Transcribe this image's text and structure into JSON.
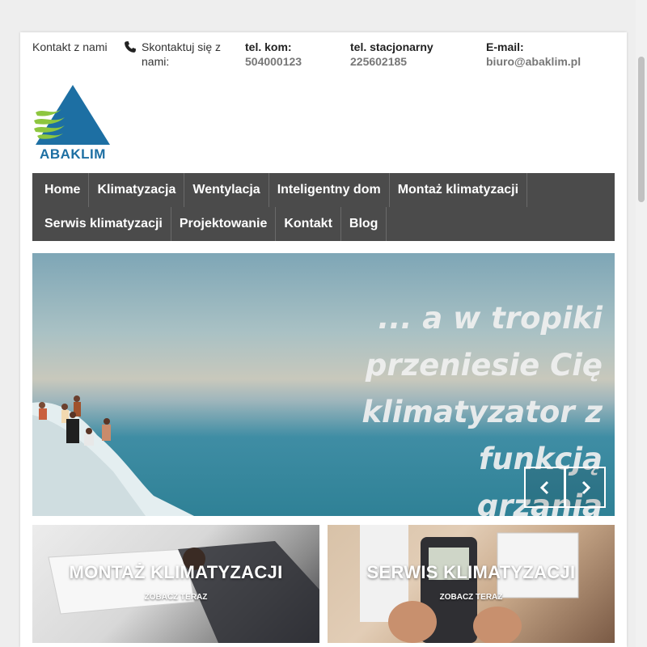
{
  "topbar": {
    "contact_label": "Kontakt z nami",
    "call_label": "Skontaktuj się z nami:",
    "mobile_label": "tel. kom:",
    "mobile_value": "504000123",
    "landline_label": "tel. stacjonarny",
    "landline_value": "225602185",
    "email_label": "E-mail:",
    "email_value": "biuro@abaklim.pl"
  },
  "logo": {
    "text": "ABAKLIM"
  },
  "nav": {
    "items": [
      {
        "label": "Home"
      },
      {
        "label": "Klimatyzacja"
      },
      {
        "label": "Wentylacja"
      },
      {
        "label": "Inteligentny dom"
      },
      {
        "label": "Montaż klimatyzacji"
      },
      {
        "label": "Serwis klimatyzacji"
      },
      {
        "label": "Projektowanie"
      },
      {
        "label": "Kontakt"
      },
      {
        "label": "Blog"
      }
    ]
  },
  "hero": {
    "caption_lines": [
      "... a w tropiki",
      "przeniesie Cię",
      "klimatyzator z funkcją",
      "grzania"
    ]
  },
  "tiles": [
    {
      "title": "MONTAŻ KLIMATYZACJI",
      "cta": "ZOBACZ TERAZ"
    },
    {
      "title": "SERWIS KLIMATYZACJI",
      "cta": "ZOBACZ TERAZ"
    }
  ],
  "colors": {
    "nav_bg": "#4b4b4b",
    "logo_blue": "#1d6fa3",
    "logo_green": "#8dc63f"
  }
}
